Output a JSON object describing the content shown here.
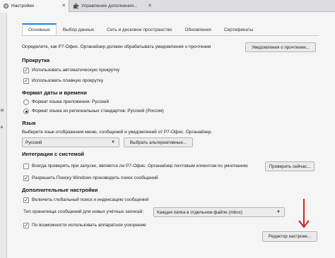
{
  "tabs": [
    {
      "label": "Настройки",
      "icon": "gear-icon"
    },
    {
      "label": "Управление дополнения...",
      "icon": "puzzle-icon"
    }
  ],
  "subtabs": [
    "Основные",
    "Выбор данных",
    "Сеть и дисковое пространство",
    "Обновления",
    "Сертификаты"
  ],
  "notifications": {
    "text": "Определите, как Р7-Офис. Органайзер должен обрабатывать уведомления о прочтении",
    "button": "Уведомления о прочтении..."
  },
  "scrolling": {
    "header": "Прокрутка",
    "auto_scroll": "Использовать автоматическую прокрутку",
    "smooth_scroll": "Использовать плавную прокрутку"
  },
  "datetime": {
    "header": "Формат даты и времени",
    "app_lang": "Формат языка приложения: Русский",
    "regional": "Формат языка из региональных стандартов: Русский (Россия)"
  },
  "language": {
    "header": "Язык",
    "text": "Выберите язык отображения меню, сообщений и уведомлений от Р7-Офис. Органайзер.",
    "selected": "Русский",
    "alt_button": "Выбрать альтернативные..."
  },
  "integration": {
    "header": "Интеграция с системой",
    "check_default": "Всегда проверять при запуске, является ли Р7-Офис. Органайзер почтовым клиентом по умолчанию",
    "check_now": "Проверить сейчас...",
    "windows_search": "Разрешить Поиску Windows производить поиск сообщений"
  },
  "advanced": {
    "header": "Дополнительные настройки",
    "global_search": "Включить глобальный поиск и индексацию сообщений",
    "store_type_label": "Тип хранилища сообщений для новых учётных записей:",
    "store_type_value": "Каждая папка в отдельном файле (mbox)",
    "hw_accel": "По возможности использовать аппаратное ускорение",
    "config_editor": "Редактор настроек..."
  },
  "sidebar_fragments": [
    "м",
    "е"
  ],
  "colors": {
    "accent": "#0a84ff",
    "annotation_arrow": "#d42020"
  }
}
